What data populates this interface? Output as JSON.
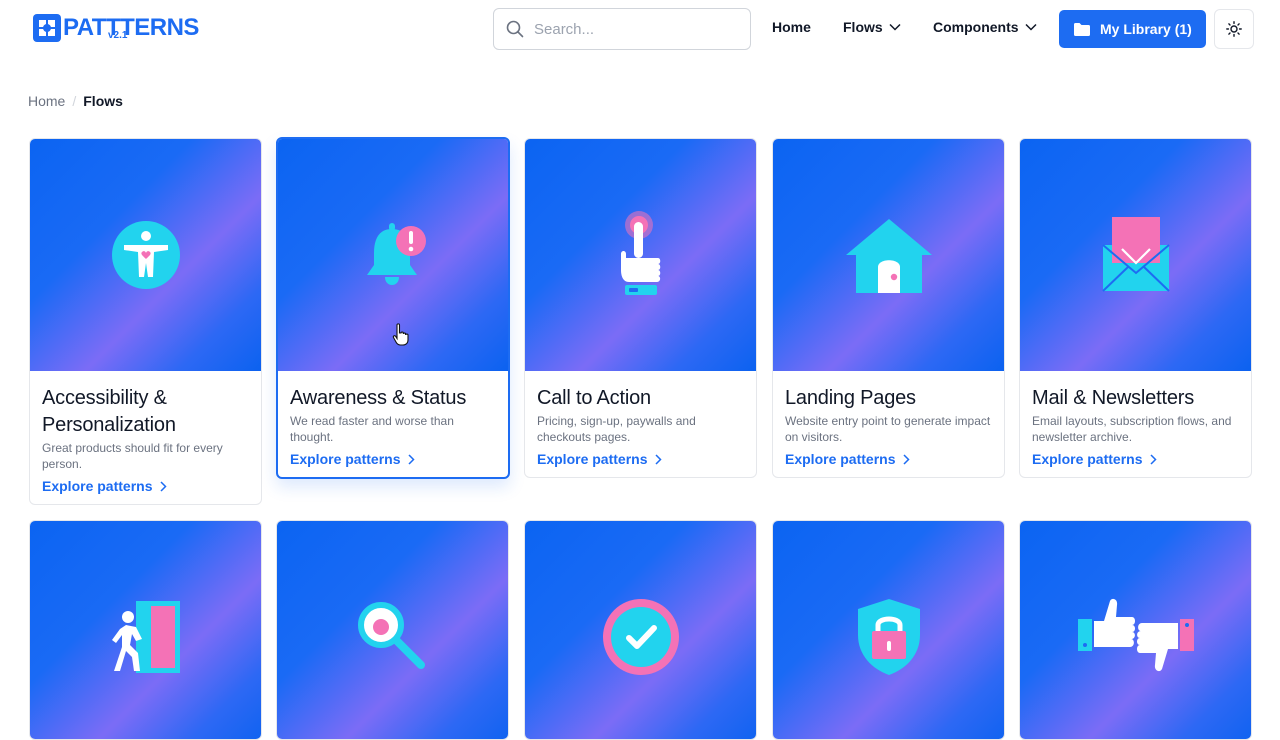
{
  "brand": {
    "name": "PATTTERNS",
    "version": "v2.1",
    "color": "#1d6cf2"
  },
  "search": {
    "placeholder": "Search..."
  },
  "nav": {
    "home": "Home",
    "flows": "Flows",
    "components": "Components",
    "library": "My Library (1)"
  },
  "breadcrumb": {
    "home": "Home",
    "separator": "/",
    "current": "Flows"
  },
  "cards": [
    {
      "title": "Accessibility & Personalization",
      "desc": "Great products should fit for every person.",
      "link": "Explore patterns",
      "icon": "accessibility-icon"
    },
    {
      "title": "Awareness & Status",
      "desc": "We read faster and worse than thought.",
      "link": "Explore patterns",
      "icon": "bell-alert-icon"
    },
    {
      "title": "Call to Action",
      "desc": "Pricing, sign-up, paywalls and checkouts pages.",
      "link": "Explore patterns",
      "icon": "tap-hand-icon"
    },
    {
      "title": "Landing Pages",
      "desc": "Website entry point to generate impact on visitors.",
      "link": "Explore patterns",
      "icon": "house-icon"
    },
    {
      "title": "Mail & Newsletters",
      "desc": "Email layouts, subscription flows, and newsletter archive.",
      "link": "Explore patterns",
      "icon": "envelope-icon"
    },
    {
      "title": "",
      "desc": "",
      "link": "",
      "icon": "exit-door-icon"
    },
    {
      "title": "",
      "desc": "",
      "link": "",
      "icon": "magnifier-icon"
    },
    {
      "title": "",
      "desc": "",
      "link": "",
      "icon": "check-circle-icon"
    },
    {
      "title": "",
      "desc": "",
      "link": "",
      "icon": "shield-lock-icon"
    },
    {
      "title": "",
      "desc": "",
      "link": "",
      "icon": "thumbs-up-down-icon"
    }
  ],
  "colors": {
    "accent": "#1d6cf2",
    "icon_cyan": "#22d3ee",
    "icon_pink": "#f472b6"
  }
}
